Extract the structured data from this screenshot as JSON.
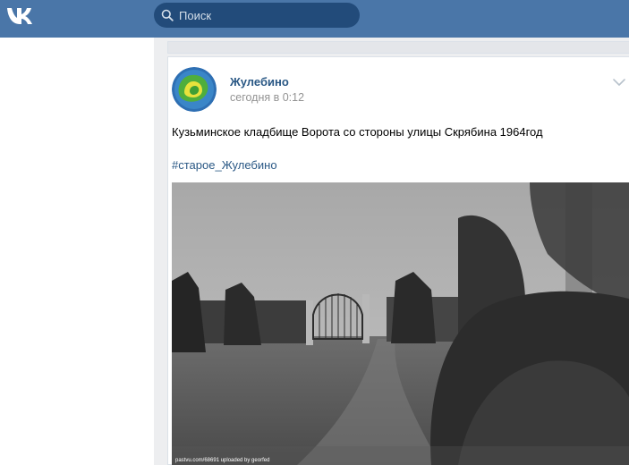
{
  "header": {
    "logo_icon": "vk-logo-icon",
    "search": {
      "placeholder": "Поиск",
      "icon": "search-icon"
    }
  },
  "post": {
    "author": "Жулебино",
    "time": "сегодня в 0:12",
    "text": "Кузьминское кладбище Ворота со стороны улицы Скрябина 1964год",
    "hashtag": "#старое_Жулебино",
    "photo_watermark": "pastvu.com/68691 uploaded by georfed",
    "menu_icon": "chevron-down-icon"
  },
  "colors": {
    "header_bg": "#4a76a8",
    "link": "#2a5885",
    "muted": "#939393"
  }
}
